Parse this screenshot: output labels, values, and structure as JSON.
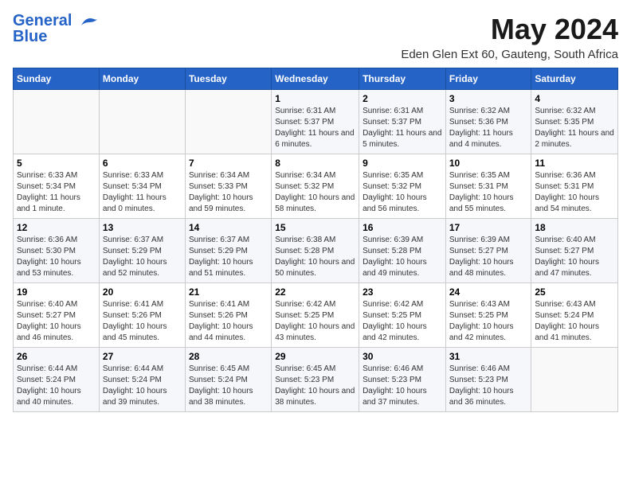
{
  "logo": {
    "line1": "General",
    "line2": "Blue"
  },
  "title": "May 2024",
  "subtitle": "Eden Glen Ext 60, Gauteng, South Africa",
  "headers": [
    "Sunday",
    "Monday",
    "Tuesday",
    "Wednesday",
    "Thursday",
    "Friday",
    "Saturday"
  ],
  "weeks": [
    [
      {
        "day": "",
        "info": ""
      },
      {
        "day": "",
        "info": ""
      },
      {
        "day": "",
        "info": ""
      },
      {
        "day": "1",
        "info": "Sunrise: 6:31 AM\nSunset: 5:37 PM\nDaylight: 11 hours and 6 minutes."
      },
      {
        "day": "2",
        "info": "Sunrise: 6:31 AM\nSunset: 5:37 PM\nDaylight: 11 hours and 5 minutes."
      },
      {
        "day": "3",
        "info": "Sunrise: 6:32 AM\nSunset: 5:36 PM\nDaylight: 11 hours and 4 minutes."
      },
      {
        "day": "4",
        "info": "Sunrise: 6:32 AM\nSunset: 5:35 PM\nDaylight: 11 hours and 2 minutes."
      }
    ],
    [
      {
        "day": "5",
        "info": "Sunrise: 6:33 AM\nSunset: 5:34 PM\nDaylight: 11 hours and 1 minute."
      },
      {
        "day": "6",
        "info": "Sunrise: 6:33 AM\nSunset: 5:34 PM\nDaylight: 11 hours and 0 minutes."
      },
      {
        "day": "7",
        "info": "Sunrise: 6:34 AM\nSunset: 5:33 PM\nDaylight: 10 hours and 59 minutes."
      },
      {
        "day": "8",
        "info": "Sunrise: 6:34 AM\nSunset: 5:32 PM\nDaylight: 10 hours and 58 minutes."
      },
      {
        "day": "9",
        "info": "Sunrise: 6:35 AM\nSunset: 5:32 PM\nDaylight: 10 hours and 56 minutes."
      },
      {
        "day": "10",
        "info": "Sunrise: 6:35 AM\nSunset: 5:31 PM\nDaylight: 10 hours and 55 minutes."
      },
      {
        "day": "11",
        "info": "Sunrise: 6:36 AM\nSunset: 5:31 PM\nDaylight: 10 hours and 54 minutes."
      }
    ],
    [
      {
        "day": "12",
        "info": "Sunrise: 6:36 AM\nSunset: 5:30 PM\nDaylight: 10 hours and 53 minutes."
      },
      {
        "day": "13",
        "info": "Sunrise: 6:37 AM\nSunset: 5:29 PM\nDaylight: 10 hours and 52 minutes."
      },
      {
        "day": "14",
        "info": "Sunrise: 6:37 AM\nSunset: 5:29 PM\nDaylight: 10 hours and 51 minutes."
      },
      {
        "day": "15",
        "info": "Sunrise: 6:38 AM\nSunset: 5:28 PM\nDaylight: 10 hours and 50 minutes."
      },
      {
        "day": "16",
        "info": "Sunrise: 6:39 AM\nSunset: 5:28 PM\nDaylight: 10 hours and 49 minutes."
      },
      {
        "day": "17",
        "info": "Sunrise: 6:39 AM\nSunset: 5:27 PM\nDaylight: 10 hours and 48 minutes."
      },
      {
        "day": "18",
        "info": "Sunrise: 6:40 AM\nSunset: 5:27 PM\nDaylight: 10 hours and 47 minutes."
      }
    ],
    [
      {
        "day": "19",
        "info": "Sunrise: 6:40 AM\nSunset: 5:27 PM\nDaylight: 10 hours and 46 minutes."
      },
      {
        "day": "20",
        "info": "Sunrise: 6:41 AM\nSunset: 5:26 PM\nDaylight: 10 hours and 45 minutes."
      },
      {
        "day": "21",
        "info": "Sunrise: 6:41 AM\nSunset: 5:26 PM\nDaylight: 10 hours and 44 minutes."
      },
      {
        "day": "22",
        "info": "Sunrise: 6:42 AM\nSunset: 5:25 PM\nDaylight: 10 hours and 43 minutes."
      },
      {
        "day": "23",
        "info": "Sunrise: 6:42 AM\nSunset: 5:25 PM\nDaylight: 10 hours and 42 minutes."
      },
      {
        "day": "24",
        "info": "Sunrise: 6:43 AM\nSunset: 5:25 PM\nDaylight: 10 hours and 42 minutes."
      },
      {
        "day": "25",
        "info": "Sunrise: 6:43 AM\nSunset: 5:24 PM\nDaylight: 10 hours and 41 minutes."
      }
    ],
    [
      {
        "day": "26",
        "info": "Sunrise: 6:44 AM\nSunset: 5:24 PM\nDaylight: 10 hours and 40 minutes."
      },
      {
        "day": "27",
        "info": "Sunrise: 6:44 AM\nSunset: 5:24 PM\nDaylight: 10 hours and 39 minutes."
      },
      {
        "day": "28",
        "info": "Sunrise: 6:45 AM\nSunset: 5:24 PM\nDaylight: 10 hours and 38 minutes."
      },
      {
        "day": "29",
        "info": "Sunrise: 6:45 AM\nSunset: 5:23 PM\nDaylight: 10 hours and 38 minutes."
      },
      {
        "day": "30",
        "info": "Sunrise: 6:46 AM\nSunset: 5:23 PM\nDaylight: 10 hours and 37 minutes."
      },
      {
        "day": "31",
        "info": "Sunrise: 6:46 AM\nSunset: 5:23 PM\nDaylight: 10 hours and 36 minutes."
      },
      {
        "day": "",
        "info": ""
      }
    ]
  ]
}
